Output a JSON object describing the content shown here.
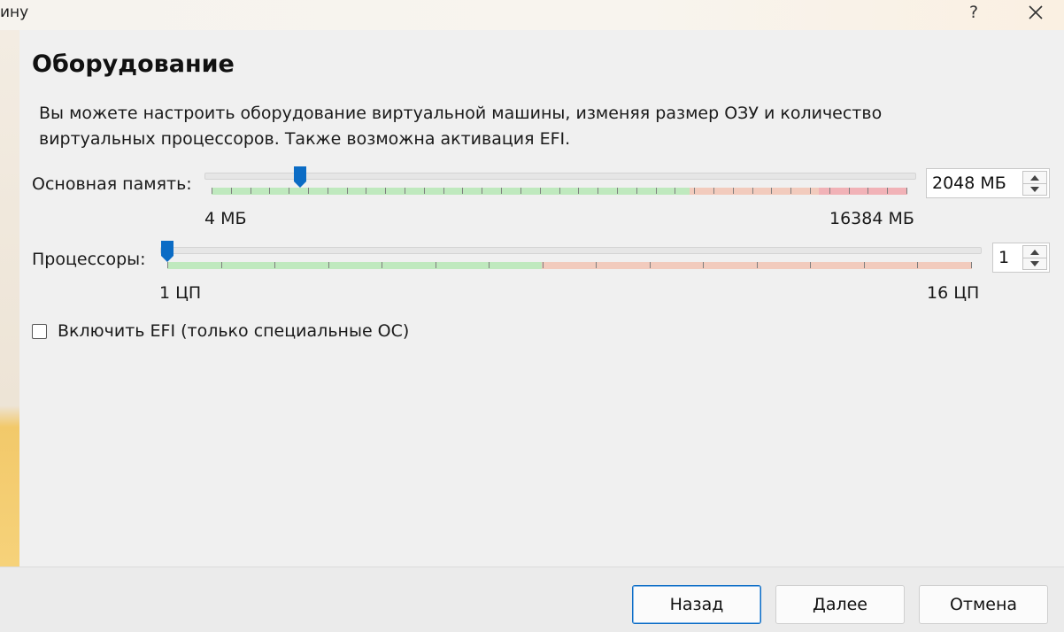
{
  "window": {
    "title_fragment": "ину",
    "help_label": "?"
  },
  "heading": "Оборудование",
  "description": "Вы можете настроить оборудование виртуальной машины, изменяя размер ОЗУ и количество виртуальных процессоров. Также возможна активация EFI.",
  "memory": {
    "label": "Основная память:",
    "value": "2048 МБ",
    "min_label": "4 МБ",
    "max_label": "16384 МБ",
    "min": 4,
    "max": 16384,
    "current": 2048
  },
  "cpu": {
    "label": "Процессоры:",
    "value": "1",
    "min_label": "1 ЦП",
    "max_label": "16 ЦП",
    "min": 1,
    "max": 16,
    "current": 1
  },
  "efi": {
    "label": "Включить EFI (только специальные ОС)",
    "checked": false
  },
  "buttons": {
    "back": "Назад",
    "next": "Далее",
    "cancel": "Отмена"
  },
  "colors": {
    "ok_zone": "#bfe9be",
    "warn_zone": "#f2cbbd",
    "danger_zone": "#f1b2b7",
    "thumb": "#0b6cc5",
    "accent": "#0b6cc5"
  }
}
